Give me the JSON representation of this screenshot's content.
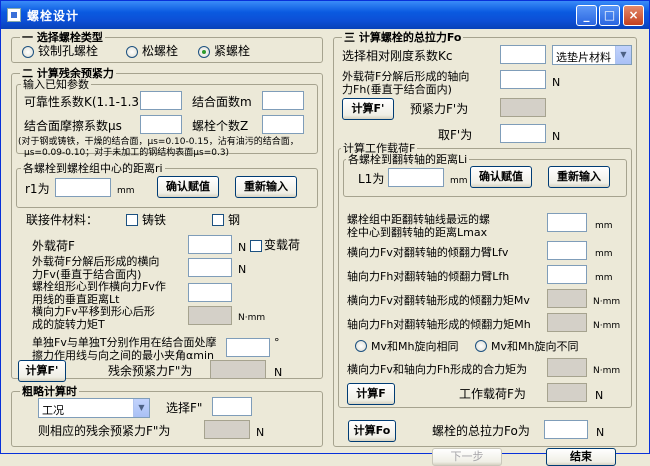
{
  "window": {
    "title": "螺栓设计",
    "min": "_",
    "max": "□",
    "close": "×"
  },
  "left": {
    "type_group": {
      "title": "一 选择螺栓类型",
      "options": [
        {
          "label": "铰制孔螺栓",
          "selected": false
        },
        {
          "label": "松螺栓",
          "selected": false
        },
        {
          "label": "紧螺栓",
          "selected": true
        }
      ]
    },
    "residual_group": {
      "title": "二 计算残余预紧力",
      "known": {
        "title": "输入已知参数",
        "reliability": "可靠性系数K(1.1-1.3)",
        "surfaces": "结合面数m",
        "friction": "结合面摩擦系数μs",
        "bolt_count": "螺栓个数Z",
        "note1": "(对于钢或铸铁，干燥的结合面，μs=0.10-0.15，沾有油污的结合面，",
        "note2": "μs=0.09-0.10；对于未加工的钢结构表面μs=0.3)"
      },
      "distance": {
        "title": "各螺栓到螺栓组中心的距离ri",
        "r1": "r1为",
        "unit": "mm",
        "confirm": "确认赋值",
        "reenter": "重新输入"
      },
      "material": {
        "label": "联接件材料：",
        "iron": "铸铁",
        "steel": "钢"
      },
      "external_load": "外载荷F",
      "unit_n": "N",
      "variable_load": "变载荷",
      "lateral_force": [
        "外载荷F分解后形成的横向",
        "力Fv(垂直于结合面内)"
      ],
      "vertical_distance": [
        "螺栓组形心到作横向力Fv作",
        "用线的垂直距离Lt"
      ],
      "torque": [
        "横向力Fv平移到形心后形",
        "成的旋转力矩T"
      ],
      "unit_nmm": "N·mm",
      "min_angle": [
        "单独Fv与单独T分别作用在结合面处摩",
        "擦力作用线与向之间的最小夹角αmin"
      ],
      "degree": "°",
      "calc_button": "计算F'",
      "residual_label": "残余预紧力F\"为"
    },
    "rough_group": {
      "title": "粗略计算时",
      "condition": "工况",
      "select_label": "选择F\"",
      "result_label": "则相应的残余预紧力F\"为",
      "unit_n": "N"
    }
  },
  "right": {
    "force_group": {
      "title": "三 计算螺栓的总拉力Fo",
      "stiffness": "选择相对刚度系数Kc",
      "gasket_select": "选垫片材料",
      "axial_force": [
        "外载荷F分解后形成的轴向",
        "力Fh(垂直于结合面内)"
      ],
      "unit_n": "N",
      "calc_button": "计算F'",
      "preload": "预紧力F'为",
      "take": "取F'为"
    },
    "work_group": {
      "title": "计算工作载荷F",
      "distance": {
        "title": "各螺栓到翻转轴的距离Li",
        "l1": "L1为",
        "unit": "mm",
        "confirm": "确认赋值",
        "reenter": "重新输入"
      },
      "lmax": [
        "螺栓组中距翻转轴线最远的螺",
        "栓中心到翻转轴的距离Lmax"
      ],
      "unit_mm": "mm",
      "lfv": "横向力Fv对翻转轴的倾翻力臂Lfv",
      "lfh": "轴向力Fh对翻转轴的倾翻力臂Lfh",
      "mv": "横向力Fv对翻转轴形成的倾翻力矩Mv",
      "mh": "轴向力Fh对翻转轴形成的倾翻力矩Mh",
      "unit_nmm": "N·mm",
      "same_direction": "Mv和Mh旋向相同",
      "diff_direction": "Mv和Mh旋向不同",
      "resultant": "横向力Fv和轴向力Fh形成的合力矩为",
      "calc_button": "计算F",
      "work_load": "工作载荷F为",
      "unit_n": "N"
    },
    "bottom": {
      "calc_button": "计算Fo",
      "total": "螺栓的总拉力Fo为",
      "unit_n": "N",
      "next": "下一步",
      "finish": "结束"
    }
  }
}
